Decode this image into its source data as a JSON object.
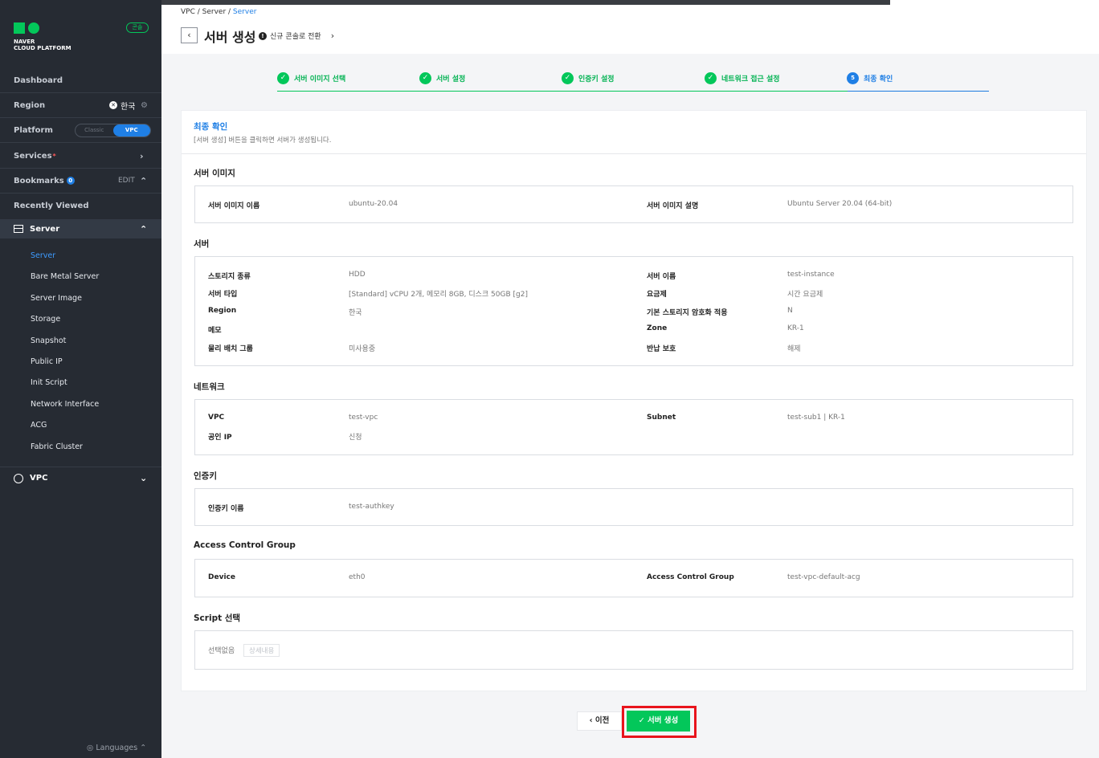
{
  "sidebar": {
    "brand_line1": "NAVER",
    "brand_line2": "CLOUD PLATFORM",
    "console_badge": "콘솔",
    "dashboard": "Dashboard",
    "region_label": "Region",
    "region_value": "한국",
    "platform_label": "Platform",
    "platform_options": [
      "Classic",
      "VPC"
    ],
    "services_label": "Services",
    "services_required_mark": "*",
    "bookmarks_label": "Bookmarks",
    "bookmarks_count": "0",
    "edit_label": "EDIT",
    "recently_viewed": "Recently Viewed",
    "server_group": "Server",
    "server_items": [
      "Server",
      "Bare Metal Server",
      "Server Image",
      "Storage",
      "Snapshot",
      "Public IP",
      "Init Script",
      "Network Interface",
      "ACG",
      "Fabric Cluster"
    ],
    "vpc_group": "VPC",
    "languages": "Languages"
  },
  "header": {
    "breadcrumb": [
      "VPC",
      "Server",
      "Server"
    ],
    "title": "서버 생성",
    "switch_link": "신규 콘솔로 전환"
  },
  "steps": [
    {
      "label": "서버 이미지 선택",
      "state": "done"
    },
    {
      "label": "서버 설정",
      "state": "done"
    },
    {
      "label": "인증키 설정",
      "state": "done"
    },
    {
      "label": "네트워크 접근 설정",
      "state": "done"
    },
    {
      "label": "최종 확인",
      "state": "current",
      "number": "5"
    }
  ],
  "panel": {
    "title": "최종 확인",
    "desc": "[서버 생성] 버튼을 클릭하면 서버가 생성됩니다.",
    "image_section": "서버 이미지",
    "image": [
      {
        "k": "서버 이미지 이름",
        "v": "ubuntu-20.04"
      },
      {
        "k": "서버 이미지 설명",
        "v": "Ubuntu Server 20.04 (64-bit)"
      }
    ],
    "server_section": "서버",
    "server_left": [
      {
        "k": "스토리지 종류",
        "v": "HDD"
      },
      {
        "k": "서버 타입",
        "v": "[Standard] vCPU 2개, 메모리 8GB, 디스크 50GB [g2]"
      },
      {
        "k": "Region",
        "v": "한국"
      },
      {
        "k": "메모",
        "v": ""
      },
      {
        "k": "물리 배치 그룹",
        "v": "미사용중"
      }
    ],
    "server_right": [
      {
        "k": "서버 이름",
        "v": "test-instance"
      },
      {
        "k": "요금제",
        "v": "시간 요금제"
      },
      {
        "k": "기본 스토리지 암호화 적용",
        "v": "N"
      },
      {
        "k": "Zone",
        "v": "KR-1"
      },
      {
        "k": "반납 보호",
        "v": "해제"
      }
    ],
    "network_section": "네트워크",
    "network": [
      {
        "k": "VPC",
        "v": "test-vpc"
      },
      {
        "k": "Subnet",
        "v": "test-sub1 | KR-1"
      },
      {
        "k": "공인 IP",
        "v": "신청"
      }
    ],
    "auth_section": "인증키",
    "auth": [
      {
        "k": "인증키 이름",
        "v": "test-authkey"
      }
    ],
    "acg_section": "Access Control Group",
    "acg": [
      {
        "k": "Device",
        "v": "eth0"
      },
      {
        "k": "Access Control Group",
        "v": "test-vpc-default-acg"
      }
    ],
    "script_section": "Script 선택",
    "script_value": "선택없음",
    "script_detail_button": "상세내용"
  },
  "footer": {
    "prev_label": "이전",
    "create_label": "서버 생성"
  },
  "colors": {
    "accent_green": "#03c75a",
    "accent_blue": "#1f7fe5",
    "highlight_red": "#e8141c"
  }
}
